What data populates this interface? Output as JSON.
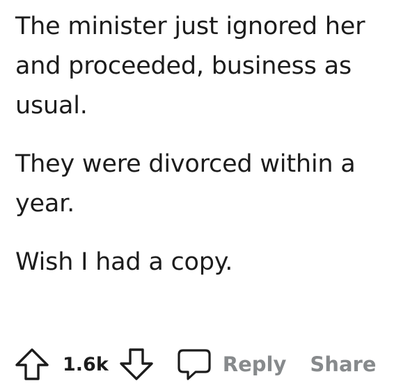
{
  "comment": {
    "paragraphs": [
      "The minister just ignored her and proceeded, business as usual.",
      "They were divorced within a year.",
      "Wish I had a copy."
    ]
  },
  "actions": {
    "upvote_icon": "arrow-up-outline-icon",
    "score": "1.6k",
    "downvote_icon": "arrow-down-outline-icon",
    "comment_icon": "speech-bubble-icon",
    "reply_label": "Reply",
    "share_label": "Share",
    "label_color": "#878a8c",
    "icon_color": "#1c1c1c"
  }
}
